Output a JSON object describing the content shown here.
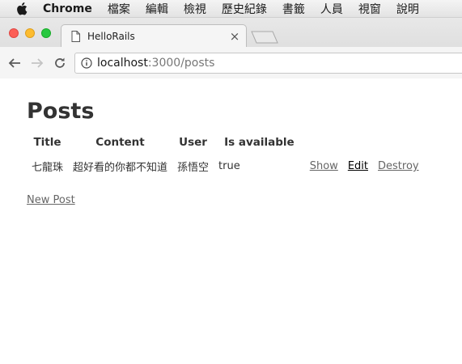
{
  "menubar": {
    "app_name": "Chrome",
    "items": [
      "檔案",
      "編輯",
      "檢視",
      "歷史紀錄",
      "書籤",
      "人員",
      "視窗",
      "說明"
    ]
  },
  "tab": {
    "title": "HelloRails",
    "close_glyph": "×"
  },
  "address": {
    "host": "localhost",
    "path": ":3000/posts"
  },
  "page": {
    "heading": "Posts",
    "columns": [
      "Title",
      "Content",
      "User",
      "Is available"
    ],
    "rows": [
      {
        "title": "七龍珠",
        "content": "超好看的你都不知道",
        "user": "孫悟空",
        "is_available": "true",
        "actions": [
          "Show",
          "Edit",
          "Destroy"
        ]
      }
    ],
    "new_post_link": "New Post"
  },
  "colors": {
    "link": "#666666",
    "edit_link": "#000000",
    "traffic_red": "#fc5f57",
    "traffic_yellow": "#fdbc2f",
    "traffic_green": "#28c840"
  },
  "icons": {
    "apple": "apple-logo-icon",
    "document": "document-icon",
    "back": "back-arrow-icon",
    "forward": "forward-arrow-icon",
    "reload": "reload-icon",
    "info": "info-icon",
    "close": "close-icon"
  }
}
